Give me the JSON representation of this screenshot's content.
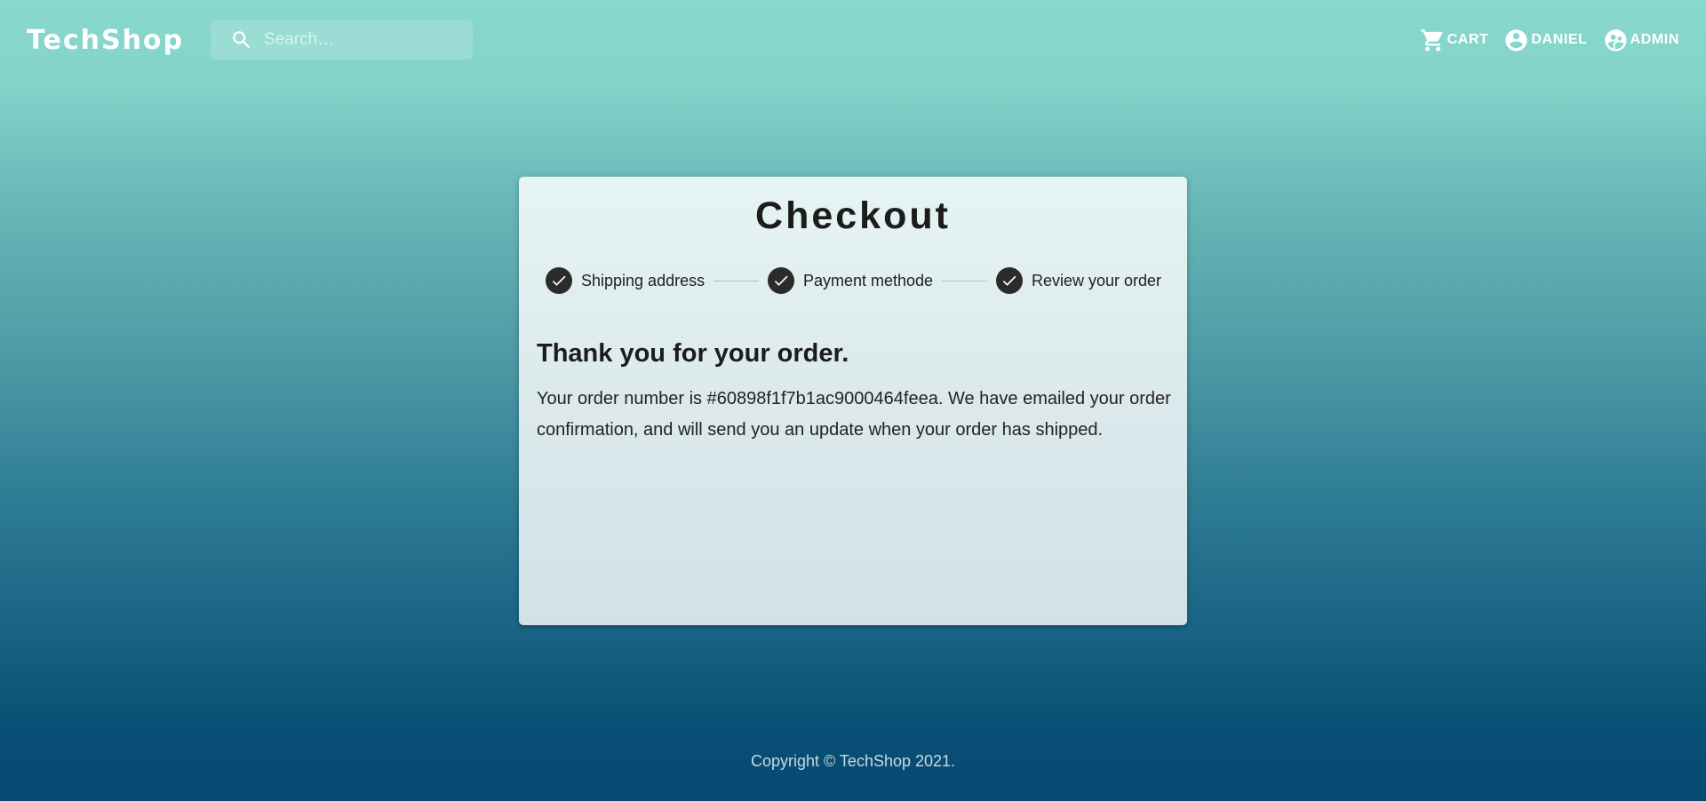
{
  "header": {
    "brand": "TechShop",
    "search_placeholder": "Search…",
    "nav": {
      "cart_label": "CART",
      "user_label": "DANIEL",
      "admin_label": "ADMIN"
    }
  },
  "checkout": {
    "title": "Checkout",
    "steps": [
      {
        "label": "Shipping address",
        "status": "completed"
      },
      {
        "label": "Payment methode",
        "status": "completed"
      },
      {
        "label": "Review your order",
        "status": "completed"
      }
    ],
    "thanks_heading": "Thank you for your order.",
    "order_message": "Your order number is #60898f1f7b1ac9000464feea. We have emailed your order confirmation, and will send you an update when your order has shipped."
  },
  "footer": {
    "copyright": "Copyright © TechShop 2021."
  },
  "icons": {
    "search": "search-icon",
    "cart": "shopping-cart-icon",
    "user": "account-circle-icon",
    "admin": "supervisor-account-icon",
    "step_done": "check-icon"
  },
  "colors": {
    "gradient_top": "#88d8cd",
    "gradient_bottom": "#064b72",
    "step_circle": "#2b2b2b"
  }
}
